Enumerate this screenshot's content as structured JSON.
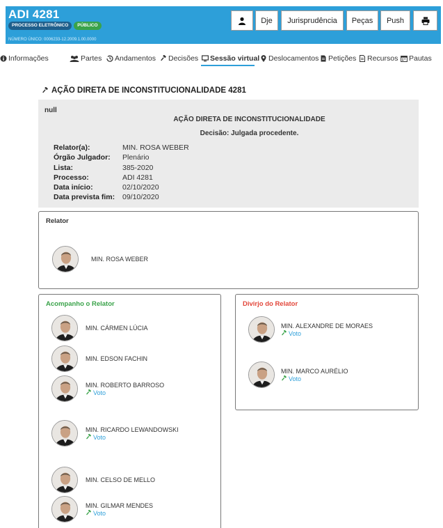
{
  "header": {
    "title": "ADI 4281",
    "badges": [
      "PROCESSO ELETRÔNICO",
      "PÚBLICO"
    ],
    "numero_unico": "NÚMERO ÚNICO: 0006233-12.2009.1.00.0000",
    "buttons": {
      "user_icon": "user-icon",
      "dje": "Dje",
      "jurisprudencia": "Jurisprudência",
      "pecas": "Peças",
      "push": "Push",
      "print_icon": "print-icon"
    },
    "color": "#2d9fd9"
  },
  "nav": {
    "items": [
      {
        "label": "Informações",
        "icon": "info-icon"
      },
      {
        "label": "Partes",
        "icon": "people-icon"
      },
      {
        "label": "Andamentos",
        "icon": "history-icon"
      },
      {
        "label": "Decisões",
        "icon": "gavel-icon"
      },
      {
        "label": "Sessão virtual",
        "icon": "monitor-icon",
        "active": true
      },
      {
        "label": "Deslocamentos",
        "icon": "location-icon"
      },
      {
        "label": "Petições",
        "icon": "document-icon"
      },
      {
        "label": "Recursos",
        "icon": "document-icon"
      },
      {
        "label": "Pautas",
        "icon": "calendar-icon"
      }
    ]
  },
  "doc_title": "AÇÃO DIRETA DE INCONSTITUCIONALIDADE 4281",
  "info": {
    "null_text": "null",
    "heading": "AÇÃO DIRETA DE INCONSTITUCIONALIDADE",
    "decisao": "Decisão: Julgada procedente.",
    "rows": [
      {
        "k": "Relator(a):",
        "v": "MIN. ROSA WEBER"
      },
      {
        "k": "Órgão Julgador:",
        "v": "Plenário"
      },
      {
        "k": "Lista:",
        "v": "385-2020"
      },
      {
        "k": "Processo:",
        "v": "ADI 4281"
      },
      {
        "k": "Data início:",
        "v": "02/10/2020"
      },
      {
        "k": "Data prevista fim:",
        "v": "09/10/2020"
      }
    ]
  },
  "relator_panel": {
    "title": "Relator",
    "minister": "MIN. ROSA WEBER"
  },
  "acompanho": {
    "title": "Acompanho o Relator",
    "title_color": "#3aa34a",
    "ministers": [
      {
        "name": "MIN. CÁRMEN LÚCIA",
        "voto": ""
      },
      {
        "name": "MIN. EDSON FACHIN",
        "voto": ""
      },
      {
        "name": "MIN. ROBERTO BARROSO",
        "voto": "Voto"
      },
      {
        "name": "MIN. RICARDO LEWANDOWSKI",
        "voto": "Voto"
      },
      {
        "name": "MIN. CELSO DE MELLO",
        "voto": ""
      },
      {
        "name": "MIN. GILMAR MENDES",
        "voto": "Voto"
      }
    ]
  },
  "divirjo": {
    "title": "Divirjo do Relator",
    "title_color": "#e2463a",
    "ministers": [
      {
        "name": "MIN. ALEXANDRE DE MORAES",
        "voto": "Voto"
      },
      {
        "name": "MIN. MARCO AURÉLIO",
        "voto": "Voto"
      }
    ]
  },
  "voto_color": "#2d9fd9"
}
